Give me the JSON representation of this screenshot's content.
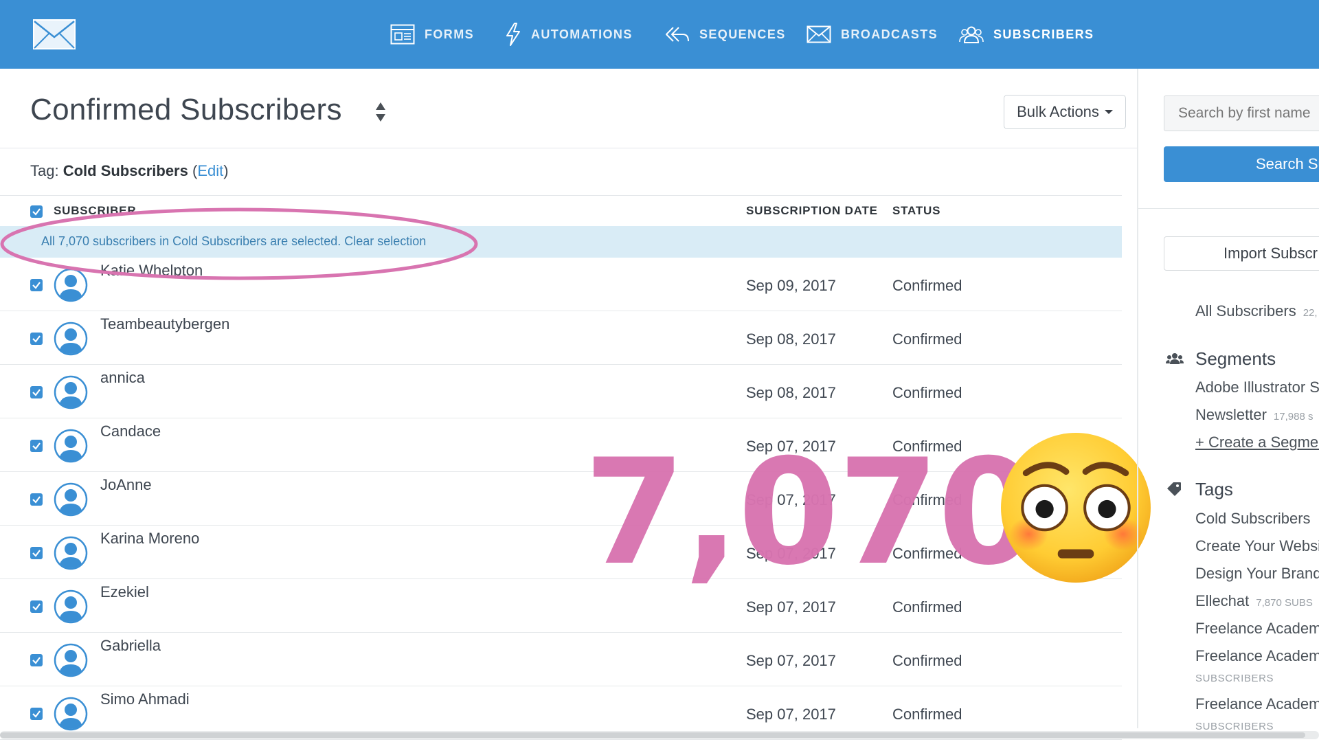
{
  "colors": {
    "brand": "#3a8fd4",
    "highlight": "#d874b0",
    "selection_bg": "#d9ecf6"
  },
  "nav": {
    "items": [
      {
        "label": "FORMS",
        "icon": "form-icon"
      },
      {
        "label": "AUTOMATIONS",
        "icon": "lightning-icon"
      },
      {
        "label": "SEQUENCES",
        "icon": "reply-all-icon"
      },
      {
        "label": "BROADCASTS",
        "icon": "envelope-icon"
      },
      {
        "label": "SUBSCRIBERS",
        "icon": "users-icon",
        "active": true
      }
    ]
  },
  "header": {
    "title": "Confirmed Subscribers",
    "bulk_actions": "Bulk Actions"
  },
  "tag": {
    "prefix": "Tag: ",
    "name": "Cold Subscribers",
    "edit_open": " (",
    "edit": "Edit",
    "edit_close": ")"
  },
  "table": {
    "columns": {
      "subscriber": "SUBSCRIBER",
      "date": "SUBSCRIPTION DATE",
      "status": "STATUS"
    },
    "selection": {
      "message": "All 7,070 subscribers in Cold Subscribers are selected.",
      "clear": "Clear selection"
    },
    "rows": [
      {
        "name": "Katie Whelpton",
        "date": "Sep 09, 2017",
        "status": "Confirmed"
      },
      {
        "name": "Teambeautybergen",
        "date": "Sep 08, 2017",
        "status": "Confirmed"
      },
      {
        "name": "annica",
        "date": "Sep 08, 2017",
        "status": "Confirmed"
      },
      {
        "name": "Candace",
        "date": "Sep 07, 2017",
        "status": "Confirmed"
      },
      {
        "name": "JoAnne",
        "date": "Sep 07, 2017",
        "status": "Confirmed"
      },
      {
        "name": "Karina Moreno",
        "date": "Sep 07, 2017",
        "status": "Confirmed"
      },
      {
        "name": "Ezekiel",
        "date": "Sep 07, 2017",
        "status": "Confirmed"
      },
      {
        "name": "Gabriella",
        "date": "Sep 07, 2017",
        "status": "Confirmed"
      },
      {
        "name": "Simo Ahmadi",
        "date": "Sep 07, 2017",
        "status": "Confirmed"
      }
    ]
  },
  "overlay": {
    "count": "7,070",
    "emoji": "flushed-face-emoji"
  },
  "sidebar": {
    "search_placeholder": "Search by first name",
    "search_button": "Search Su",
    "import_button": "Import Subscr",
    "all_subscribers": {
      "label": "All Subscribers",
      "count": "22,"
    },
    "segments": {
      "heading": "Segments",
      "items": [
        {
          "label": "Adobe Illustrator S",
          "count": ""
        },
        {
          "label": "Newsletter",
          "count": "17,988 s"
        }
      ],
      "create": "+ Create a Segmen"
    },
    "tags": {
      "heading": "Tags",
      "items": [
        {
          "label": "Cold Subscribers",
          "count": "",
          "sub": ""
        },
        {
          "label": "Create Your Websi",
          "count": "",
          "sub": ""
        },
        {
          "label": "Design Your Brand",
          "count": "",
          "sub": ""
        },
        {
          "label": "Ellechat",
          "count": "7,870 SUBS",
          "sub": ""
        },
        {
          "label": "Freelance Academ",
          "count": "",
          "sub": ""
        },
        {
          "label": "Freelance Academ",
          "count": "",
          "sub": "SUBSCRIBERS"
        },
        {
          "label": "Freelance Academ",
          "count": "",
          "sub": "SUBSCRIBERS"
        }
      ]
    }
  }
}
